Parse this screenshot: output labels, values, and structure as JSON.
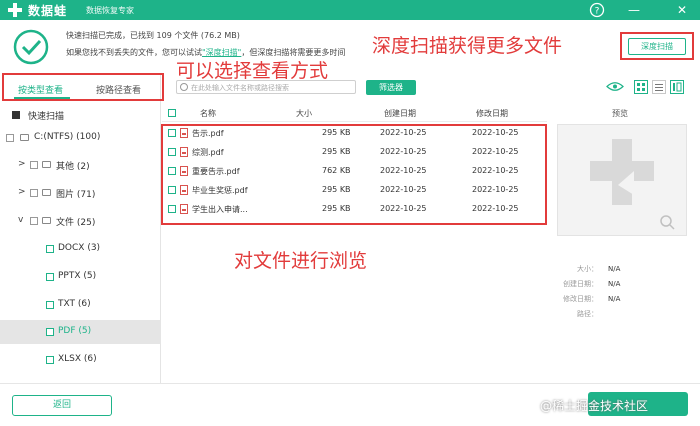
{
  "titlebar": {
    "app_name": "数据蛙",
    "subtitle": "数据恢复专家",
    "help_glyph": "?",
    "min_glyph": "—",
    "close_glyph": "✕"
  },
  "header": {
    "scan_status": "快速扫描已完成，已找到 109 个文件 (76.2 MB)",
    "hint_prefix": "如果您找不到丢失的文件，您可以试试",
    "hint_link": "\"深度扫描\"",
    "hint_suffix": "，但深度扫描将需要更多时间",
    "deep_scan_button": "深度扫描"
  },
  "annotations": {
    "deep_scan": "深度扫描获得更多文件",
    "view_mode": "可以选择查看方式",
    "browse": "对文件进行浏览"
  },
  "left_panel": {
    "tab_by_type": "按类型查看",
    "tab_by_path": "按路径查看",
    "quick_scan": "快速扫描",
    "tree": [
      {
        "label": "C:(NTFS) (100)"
      },
      {
        "label": "其他 (2)"
      },
      {
        "label": "图片 (71)"
      },
      {
        "label": "文件 (25)"
      },
      {
        "label": "DOCX (3)"
      },
      {
        "label": "PPTX (5)"
      },
      {
        "label": "TXT (6)"
      },
      {
        "label": "PDF (5)"
      },
      {
        "label": "XLSX (6)"
      }
    ]
  },
  "toolbar": {
    "search_placeholder": "在此处输入文件名称或路径搜索",
    "filter_button": "筛选器"
  },
  "table": {
    "headers": [
      "名称",
      "大小",
      "创建日期",
      "修改日期"
    ],
    "rows": [
      {
        "name": "告示.pdf",
        "size": "295 KB",
        "created": "2022-10-25",
        "modified": "2022-10-25"
      },
      {
        "name": "综测.pdf",
        "size": "295 KB",
        "created": "2022-10-25",
        "modified": "2022-10-25"
      },
      {
        "name": "重要告示.pdf",
        "size": "762 KB",
        "created": "2022-10-25",
        "modified": "2022-10-25"
      },
      {
        "name": "毕业生奖惩.pdf",
        "size": "295 KB",
        "created": "2022-10-25",
        "modified": "2022-10-25"
      },
      {
        "name": "学生出入申请...",
        "size": "295 KB",
        "created": "2022-10-25",
        "modified": "2022-10-25"
      }
    ]
  },
  "preview": {
    "label": "预览",
    "meta": [
      {
        "key": "大小：",
        "value": "N/A"
      },
      {
        "key": "创建日期：",
        "value": "N/A"
      },
      {
        "key": "修改日期：",
        "value": "N/A"
      },
      {
        "key": "路径：",
        "value": ""
      }
    ]
  },
  "bottom": {
    "back_button": "返回",
    "watermark": "@稀土掘金技术社区"
  },
  "colors": {
    "accent": "#1eb389",
    "annotation": "#e23b3b"
  }
}
